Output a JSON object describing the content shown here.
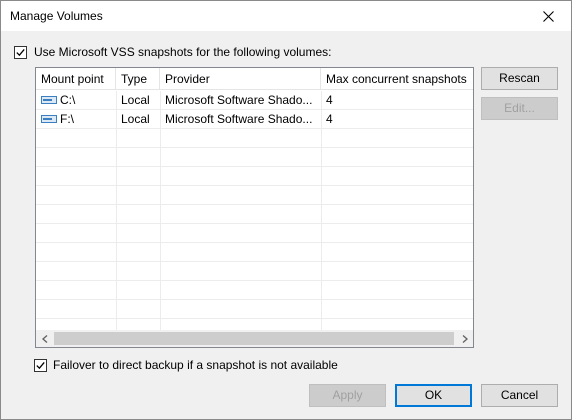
{
  "window": {
    "title": "Manage Volumes"
  },
  "vss_checkbox": {
    "label": "Use Microsoft VSS snapshots for the following volumes:",
    "checked": true
  },
  "grid": {
    "columns": [
      "Mount point",
      "Type",
      "Provider",
      "Max concurrent snapshots"
    ],
    "rows": [
      {
        "mount": "C:\\",
        "type": "Local",
        "provider": "Microsoft Software Shado...",
        "max": "4",
        "icon": "drive-icon"
      },
      {
        "mount": "F:\\",
        "type": "Local",
        "provider": "Microsoft Software Shado...",
        "max": "4",
        "icon": "drive-icon"
      }
    ]
  },
  "side_buttons": {
    "rescan": "Rescan",
    "edit": "Edit..."
  },
  "failover_checkbox": {
    "label": "Failover to direct backup if a snapshot is not available",
    "checked": true
  },
  "footer_buttons": {
    "apply": "Apply",
    "ok": "OK",
    "cancel": "Cancel"
  }
}
